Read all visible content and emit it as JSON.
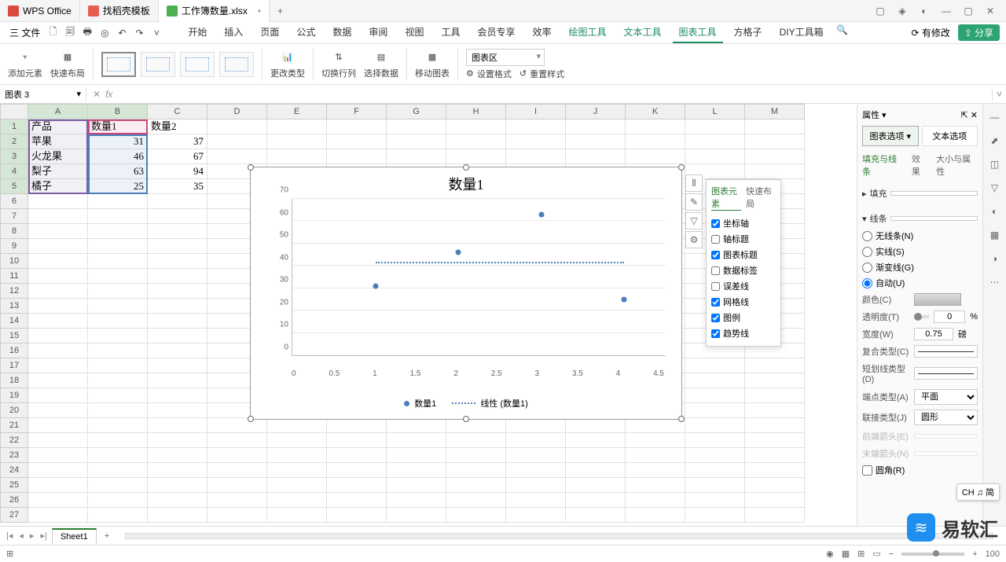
{
  "tabs": [
    {
      "label": "WPS Office"
    },
    {
      "label": "找稻壳模板"
    },
    {
      "label": "工作簿数量.xlsx"
    }
  ],
  "menubar": {
    "file": "三 文件",
    "items": [
      "开始",
      "插入",
      "页面",
      "公式",
      "数据",
      "审阅",
      "视图",
      "工具",
      "会员专享",
      "效率",
      "绘图工具",
      "文本工具",
      "图表工具",
      "方格子",
      "DIY工具箱"
    ],
    "unsaved": "有修改",
    "share": "分享"
  },
  "ribbon": {
    "add_element": "添加元素",
    "quick_layout": "快速布局",
    "change_type": "更改类型",
    "switch_rc": "切换行列",
    "select_data": "选择数据",
    "move_chart": "移动图表",
    "area_select": "图表区",
    "set_format": "设置格式",
    "reset_style": "重置样式"
  },
  "namebox": "图表 3",
  "columns": [
    "A",
    "B",
    "C",
    "D",
    "E",
    "F",
    "G",
    "H",
    "I",
    "J",
    "K",
    "L",
    "M"
  ],
  "table": {
    "headers": [
      "产品",
      "数量1",
      "数量2"
    ],
    "rows": [
      {
        "p": "苹果",
        "q1": "31",
        "q2": "37"
      },
      {
        "p": "火龙果",
        "q1": "46",
        "q2": "67"
      },
      {
        "p": "梨子",
        "q1": "63",
        "q2": "94"
      },
      {
        "p": "橘子",
        "q1": "25",
        "q2": "35"
      }
    ]
  },
  "chart_data": {
    "type": "scatter",
    "title": "数量1",
    "series_name": "数量1",
    "trend_name": "线性 (数量1)",
    "x": [
      1,
      2,
      3,
      4
    ],
    "y": [
      31,
      46,
      63,
      25
    ],
    "xticks": [
      "0",
      "0.5",
      "1",
      "1.5",
      "2",
      "2.5",
      "3",
      "3.5",
      "4",
      "4.5"
    ],
    "yticks": [
      "0",
      "10",
      "20",
      "30",
      "40",
      "50",
      "60",
      "70"
    ],
    "ylim": [
      0,
      70
    ],
    "xlim": [
      0,
      4.5
    ]
  },
  "chart_popup": {
    "tab1": "图表元素",
    "tab2": "快速布局",
    "items": [
      {
        "label": "坐标轴",
        "checked": true
      },
      {
        "label": "轴标题",
        "checked": false
      },
      {
        "label": "图表标题",
        "checked": true
      },
      {
        "label": "数据标签",
        "checked": false
      },
      {
        "label": "误差线",
        "checked": false
      },
      {
        "label": "网格线",
        "checked": true
      },
      {
        "label": "图例",
        "checked": true
      },
      {
        "label": "趋势线",
        "checked": true
      }
    ]
  },
  "right_panel": {
    "title": "属性",
    "tab_chart": "图表选项",
    "tab_text": "文本选项",
    "sub_fill": "填充与线条",
    "sub_effect": "效果",
    "sub_size": "大小与属性",
    "sec_fill": "填充",
    "sec_line": "线条",
    "line_none": "无线条(N)",
    "line_solid": "实线(S)",
    "line_grad": "渐变线(G)",
    "line_auto": "自动(U)",
    "color": "颜色(C)",
    "trans": "透明度(T)",
    "trans_val": "0",
    "trans_unit": "%",
    "width": "宽度(W)",
    "width_val": "0.75",
    "width_unit": "磅",
    "compound": "复合类型(C)",
    "dash": "短划线类型(D)",
    "cap": "端点类型(A)",
    "cap_val": "平面",
    "join": "联接类型(J)",
    "join_val": "圆形",
    "arrow_s": "前端箭头(E)",
    "arrow_e": "末端箭头(N)",
    "round": "圆角(R)"
  },
  "sheet": {
    "name": "Sheet1"
  },
  "status": {
    "zoom": "100"
  },
  "ime": "CH ♫ 简",
  "watermark": "易软汇"
}
